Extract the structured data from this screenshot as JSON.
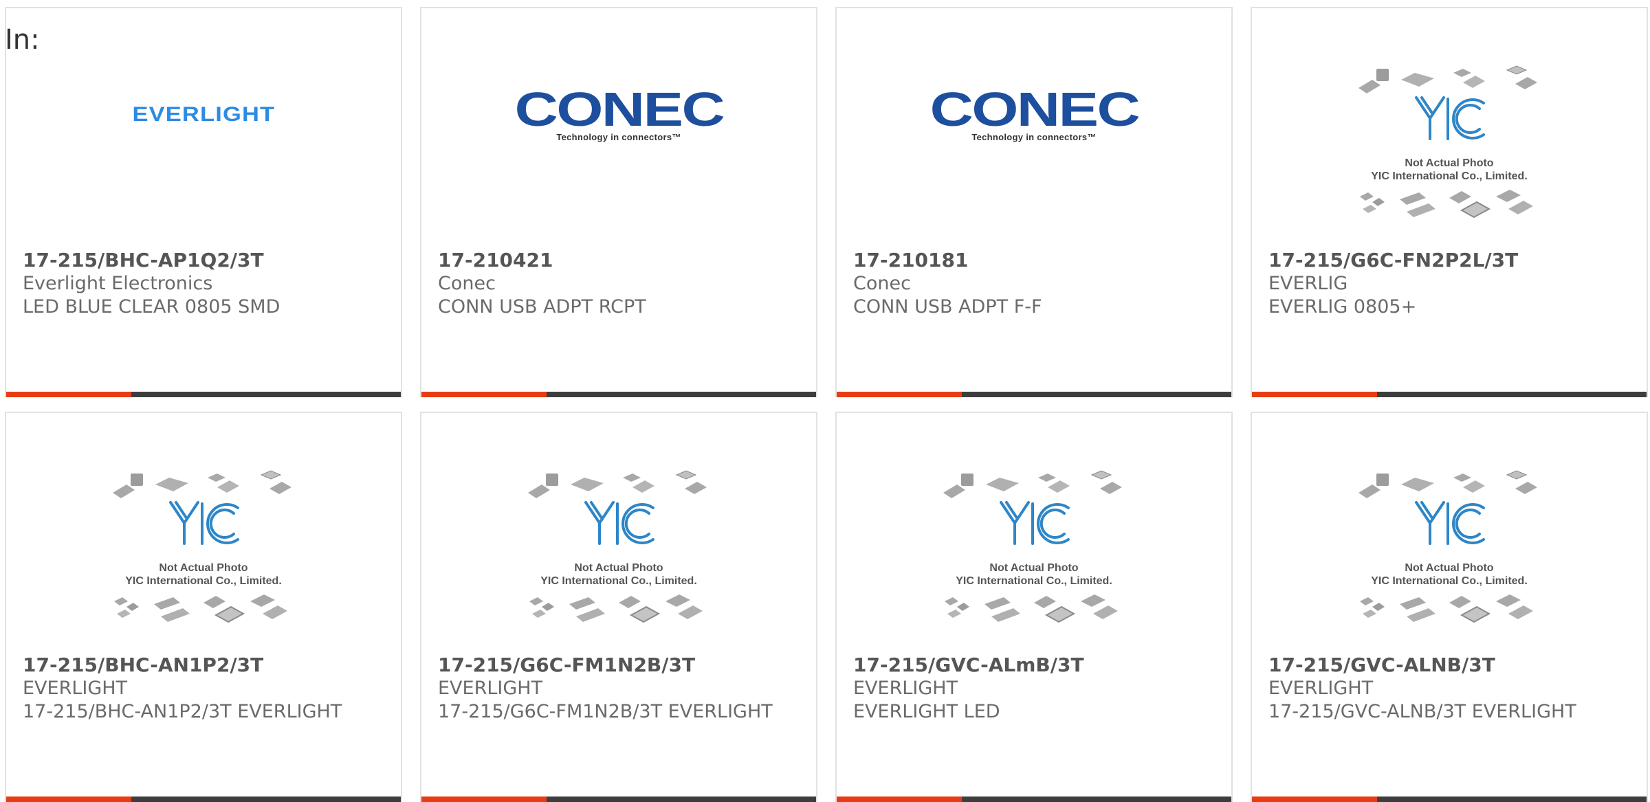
{
  "header": {
    "in_label": "In:"
  },
  "colors": {
    "accent": "#e83c14",
    "bar": "#3d3d3d",
    "logo_blue": "#2c8be4",
    "conec_blue": "#1d4f9e"
  },
  "placeholder": {
    "line1": "Not Actual Photo",
    "line2": "YIC International Co., Limited."
  },
  "logos": {
    "everlight": "EVERLIGHT",
    "conec_word": "CONEC",
    "conec_tag": "Technology in connectors™"
  },
  "cards": [
    {
      "part": "17-215/BHC-AP1Q2/3T",
      "manufacturer": "Everlight Electronics",
      "description": "LED BLUE CLEAR 0805 SMD",
      "image": "everlight-logo"
    },
    {
      "part": "17-210421",
      "manufacturer": "Conec",
      "description": "CONN USB ADPT RCPT",
      "image": "conec-logo"
    },
    {
      "part": "17-210181",
      "manufacturer": "Conec",
      "description": "CONN USB ADPT F-F",
      "image": "conec-logo"
    },
    {
      "part": "17-215/G6C-FN2P2L/3T",
      "manufacturer": "EVERLIG",
      "description": "EVERLIG 0805+",
      "image": "yic-placeholder"
    },
    {
      "part": "17-215/BHC-AN1P2/3T",
      "manufacturer": "EVERLIGHT",
      "description": "17-215/BHC-AN1P2/3T EVERLIGHT",
      "image": "yic-placeholder"
    },
    {
      "part": "17-215/G6C-FM1N2B/3T",
      "manufacturer": "EVERLIGHT",
      "description": "17-215/G6C-FM1N2B/3T EVERLIGHT",
      "image": "yic-placeholder"
    },
    {
      "part": "17-215/GVC-ALmB/3T",
      "manufacturer": "EVERLIGHT",
      "description": "EVERLIGHT LED",
      "image": "yic-placeholder"
    },
    {
      "part": "17-215/GVC-ALNB/3T",
      "manufacturer": "EVERLIGHT",
      "description": "17-215/GVC-ALNB/3T EVERLIGHT",
      "image": "yic-placeholder"
    }
  ]
}
